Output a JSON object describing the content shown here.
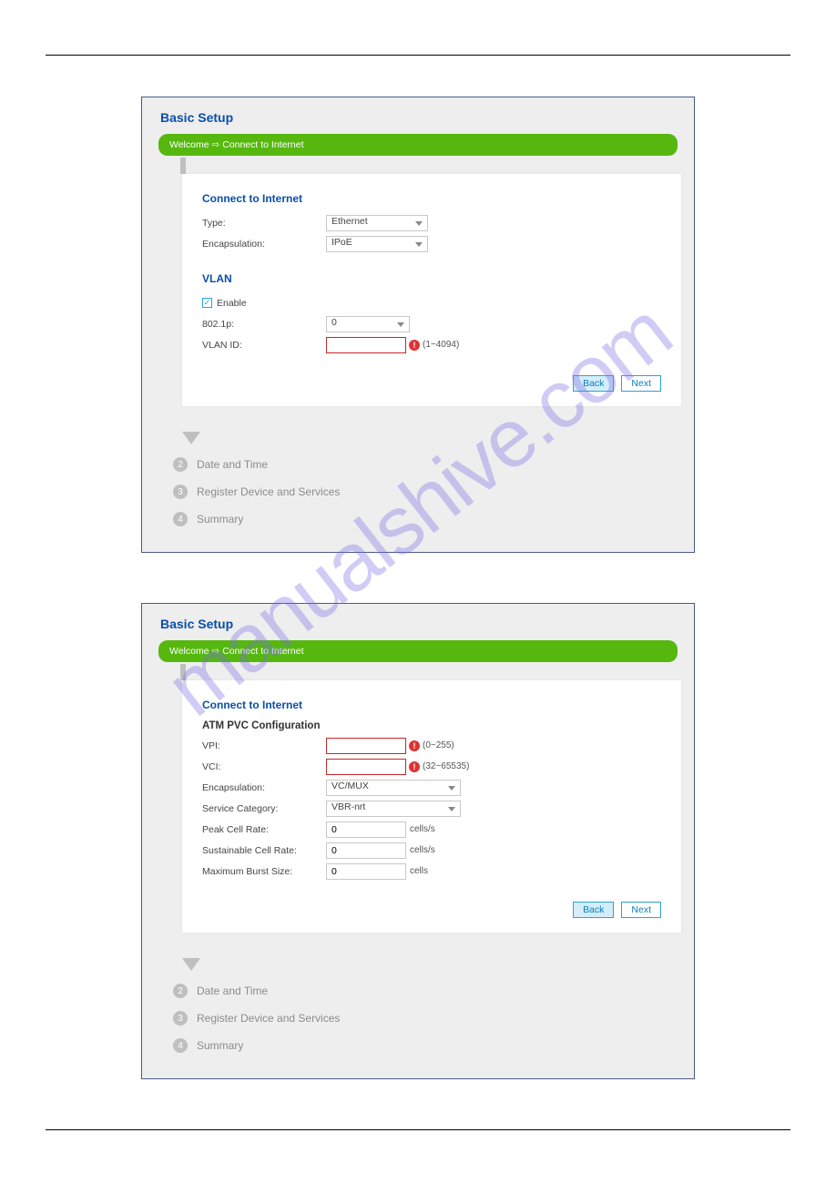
{
  "watermark": "manualshive.com",
  "panel1": {
    "title": "Basic Setup",
    "breadcrumb": "Welcome ⇨ Connect to Internet",
    "section": "Connect to Internet",
    "type_label": "Type:",
    "type_value": "Ethernet",
    "encap_label": "Encapsulation:",
    "encap_value": "IPoE",
    "vlan_header": "VLAN",
    "enable_label": "Enable",
    "p_label": "802.1p:",
    "p_value": "0",
    "vlanid_label": "VLAN ID:",
    "vlanid_value": "",
    "vlanid_hint": "(1~4094)",
    "back": "Back",
    "next": "Next",
    "step2": "Date and Time",
    "step3": "Register Device and Services",
    "step4": "Summary"
  },
  "panel2": {
    "title": "Basic Setup",
    "breadcrumb": "Welcome ⇨ Connect to Internet",
    "section": "Connect to Internet",
    "atm_header": "ATM PVC Configuration",
    "vpi_label": "VPI:",
    "vpi_value": "",
    "vpi_hint": "(0~255)",
    "vci_label": "VCI:",
    "vci_value": "",
    "vci_hint": "(32~65535)",
    "encap_label": "Encapsulation:",
    "encap_value": "VC/MUX",
    "svc_label": "Service Category:",
    "svc_value": "VBR-nrt",
    "pcr_label": "Peak Cell Rate:",
    "pcr_value": "0",
    "pcr_unit": "cells/s",
    "scr_label": "Sustainable Cell Rate:",
    "scr_value": "0",
    "scr_unit": "cells/s",
    "mbs_label": "Maximum Burst Size:",
    "mbs_value": "0",
    "mbs_unit": "cells",
    "back": "Back",
    "next": "Next",
    "step2": "Date and Time",
    "step3": "Register Device and Services",
    "step4": "Summary"
  }
}
